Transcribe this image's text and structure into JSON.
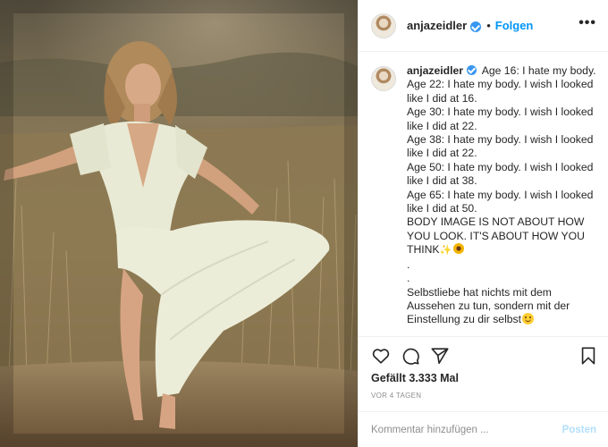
{
  "post": {
    "username": "anjazeidler",
    "separator": "•",
    "follow_label": "Folgen",
    "more_label": "•••",
    "caption_lines": [
      "Age 16: I hate my body.",
      "Age 22: I hate my body. I wish I looked",
      "like I did at 16.",
      "Age 30: I hate my body. I wish I looked",
      "like I did at 22.",
      "Age 38: I hate my body. I wish I looked",
      "like I did at 22.",
      "Age 50: I hate my body. I wish I looked",
      "like I did at 38.",
      "Age 65: I hate my body. I wish I looked",
      "like I did at 50.",
      "BODY IMAGE IS NOT ABOUT HOW",
      "YOU LOOK. IT'S ABOUT HOW YOU",
      "THINK",
      ".",
      ".",
      "Selbstliebe hat nichts mit dem",
      "Aussehen zu tun, sondern mit der",
      "Einstellung zu dir selbst"
    ],
    "likes": "Gefällt 3.333 Mal",
    "timestamp": "VOR 4 TAGEN",
    "comment_placeholder": "Kommentar hinzufügen ...",
    "post_button": "Posten"
  },
  "icons": {
    "verified": "verified-badge-icon",
    "like": "heart-icon",
    "comment": "comment-bubble-icon",
    "share": "paper-plane-icon",
    "save": "bookmark-icon",
    "more": "more-dots-icon"
  },
  "colors": {
    "follow_blue": "#0095f6",
    "verified_blue": "#3897f0",
    "post_button_disabled": "#b2dffc",
    "muted_text": "#8e8e8e"
  }
}
